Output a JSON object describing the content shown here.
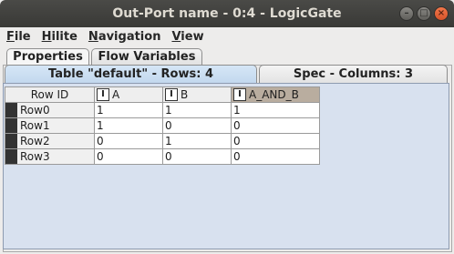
{
  "window": {
    "title": "Out-Port name - 0:4 - LogicGate"
  },
  "menubar": {
    "file": "File",
    "hilite": "Hilite",
    "navigation": "Navigation",
    "view": "View"
  },
  "outer_tabs": {
    "properties": "Properties",
    "flow_variables": "Flow Variables"
  },
  "inner_tabs": {
    "table": "Table \"default\" - Rows: 4",
    "spec": "Spec - Columns: 3"
  },
  "table": {
    "row_id_header": "Row ID",
    "type_badge": "I",
    "columns": [
      "A",
      "B",
      "A_AND_B"
    ],
    "rows": [
      {
        "id": "Row0",
        "cells": [
          "1",
          "1",
          "1"
        ]
      },
      {
        "id": "Row1",
        "cells": [
          "1",
          "0",
          "0"
        ]
      },
      {
        "id": "Row2",
        "cells": [
          "0",
          "1",
          "0"
        ]
      },
      {
        "id": "Row3",
        "cells": [
          "0",
          "0",
          "0"
        ]
      }
    ]
  }
}
